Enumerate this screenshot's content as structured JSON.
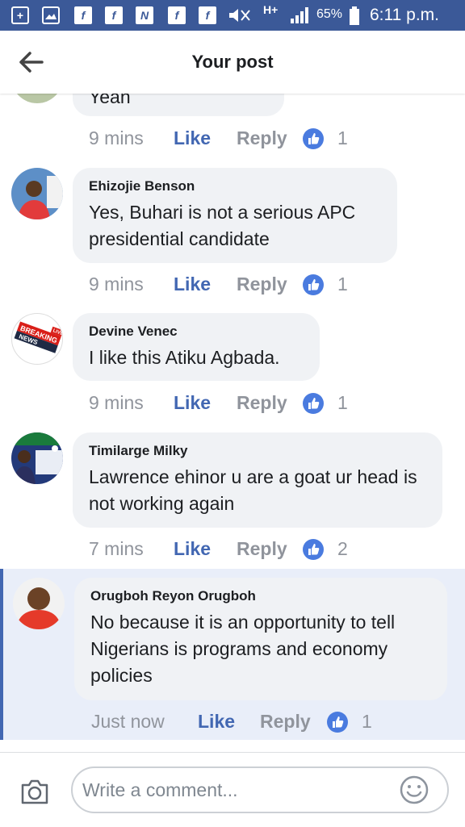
{
  "status_bar": {
    "notif_icons": [
      "plus-icon",
      "image-icon",
      "facebook-icon",
      "facebook-icon",
      "n-app-icon",
      "facebook-icon",
      "facebook-icon"
    ],
    "network": "H+",
    "battery": "65%",
    "time": "6:11 p.m."
  },
  "header": {
    "title": "Your post"
  },
  "comments": [
    {
      "name": "",
      "text": "Yeah",
      "time": "9 mins",
      "like": "Like",
      "reply": "Reply",
      "reactions": "1"
    },
    {
      "name": "Ehizojie Benson",
      "text": "Yes, Buhari is not a serious APC presidential candidate",
      "time": "9 mins",
      "like": "Like",
      "reply": "Reply",
      "reactions": "1"
    },
    {
      "name": "Devine Venec",
      "text": "I like this Atiku Agbada.",
      "time": "9 mins",
      "like": "Like",
      "reply": "Reply",
      "reactions": "1",
      "avatar_text": [
        "BREAKING",
        "NEWS",
        "LIVE"
      ]
    },
    {
      "name": "Timilarge Milky",
      "text": "Lawrence ehinor u are a goat ur head is not working again",
      "time": "7 mins",
      "like": "Like",
      "reply": "Reply",
      "reactions": "2"
    },
    {
      "name": "Orugboh Reyon Orugboh",
      "text": "No because it is an opportunity to tell Nigerians is programs and economy policies",
      "time": "Just now",
      "like": "Like",
      "reply": "Reply",
      "reactions": "1"
    }
  ],
  "composer": {
    "placeholder": "Write a comment..."
  },
  "colors": {
    "brand": "#3b5998",
    "like": "#4267b2",
    "bubble": "#f0f2f5",
    "highlight": "#e9eef9"
  }
}
